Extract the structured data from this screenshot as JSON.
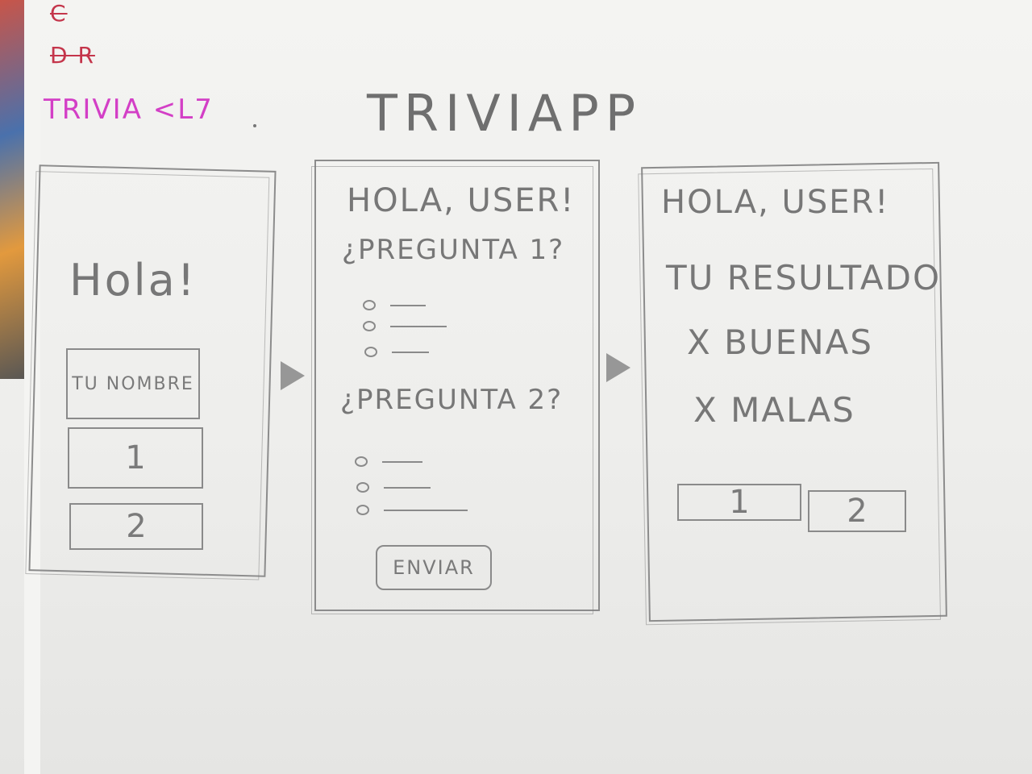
{
  "app_title": "TRIVIAPP",
  "notes": {
    "line3": "TRIVIA <L7",
    "line1_scribble": "C",
    "line2_scribble": "D    R"
  },
  "screen1": {
    "greeting": "Hola!",
    "name_input": "TU NOMBRE",
    "button1": "1",
    "button2": "2"
  },
  "screen2": {
    "greeting": "HOLA, USER!",
    "question1": "¿PREGUNTA 1?",
    "question2": "¿PREGUNTA 2?",
    "submit": "ENVIAR"
  },
  "screen3": {
    "greeting": "HOLA, USER!",
    "result_title": "TU RESULTADO",
    "good": "X BUENAS",
    "bad": "X MALAS",
    "button1": "1",
    "button2": "2"
  }
}
